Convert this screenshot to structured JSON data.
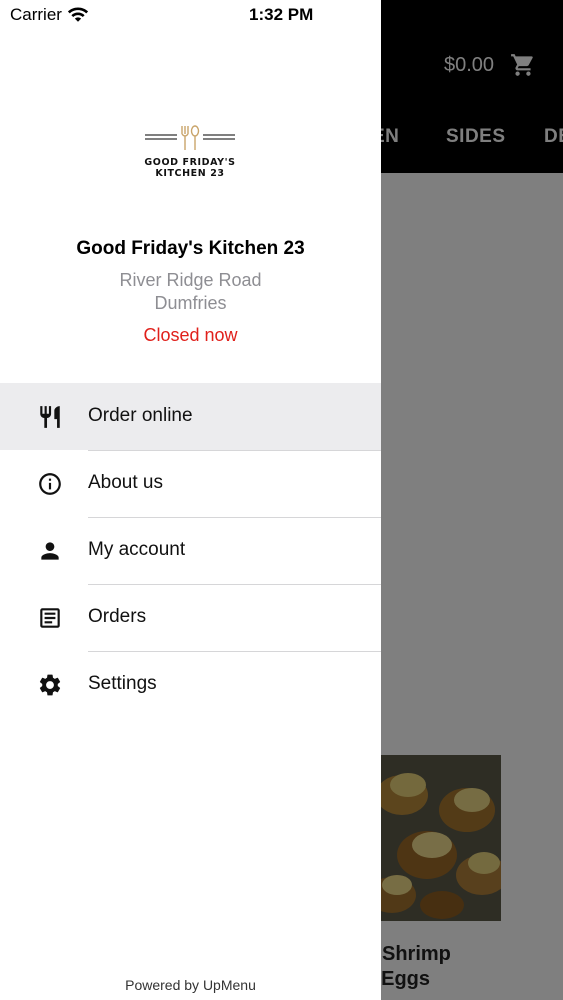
{
  "status_bar": {
    "carrier": "Carrier",
    "time": "1:32 PM"
  },
  "background": {
    "cart_total": "$0.00",
    "tabs": [
      "EN",
      "SIDES",
      "DE"
    ],
    "card_title_line1": "Shrimp",
    "card_title_line2": "l Eggs"
  },
  "drawer": {
    "logo": {
      "line1": "GOOD FRIDAY'S",
      "line2": "KITCHEN 23",
      "accent_color": "#c9a46a"
    },
    "restaurant_name": "Good Friday's Kitchen 23",
    "address_line1": "River Ridge Road",
    "address_line2": "Dumfries",
    "status": "Closed now",
    "status_color": "#e0201b",
    "menu": [
      {
        "label": "Order online",
        "icon": "cutlery-icon",
        "active": true
      },
      {
        "label": "About us",
        "icon": "info-icon",
        "active": false
      },
      {
        "label": "My account",
        "icon": "person-icon",
        "active": false
      },
      {
        "label": "Orders",
        "icon": "receipt-icon",
        "active": false
      },
      {
        "label": "Settings",
        "icon": "gear-icon",
        "active": false
      }
    ],
    "footer": "Powered by UpMenu"
  }
}
